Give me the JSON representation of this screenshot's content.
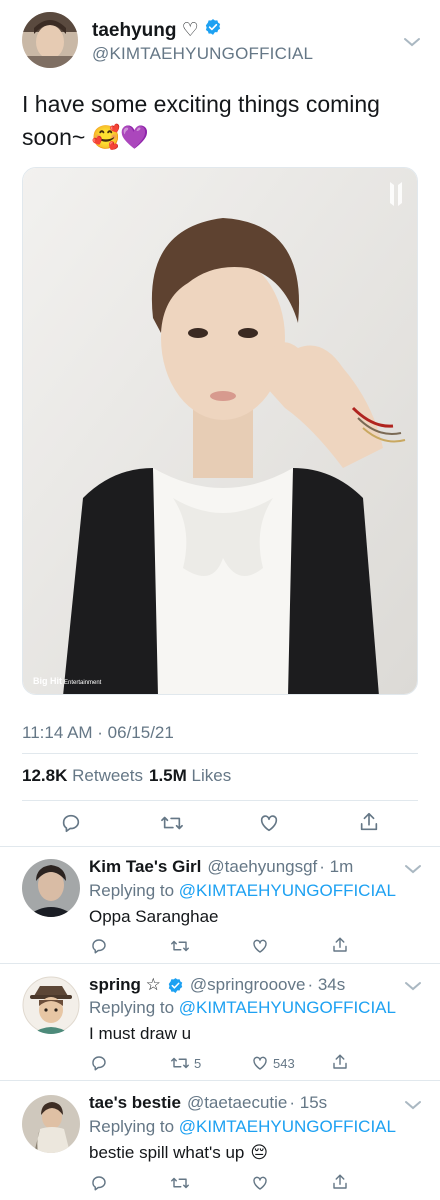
{
  "main_tweet": {
    "display_name": "taehyung ♡",
    "handle": "@KIMTAEHYUNGOFFICIAL",
    "text": "I have some exciting things coming soon~",
    "emoji": "🥰💜",
    "media_watermark": "Big Hit",
    "media_watermark_sub": "Entertainment",
    "timestamp": "11:14 AM · 06/15/21",
    "retweets_count": "12.8K",
    "retweets_label": "Retweets",
    "likes_count": "1.5M",
    "likes_label": "Likes"
  },
  "replies": [
    {
      "name": "Kim Tae's Girl",
      "handle": "@taehyungsgf",
      "time": "· 1m",
      "verified": false,
      "replying_prefix": "Replying to",
      "replying_to": "@KIMTAEHYUNGOFFICIAL",
      "text": "Oppa Saranghae",
      "retweet_count": "",
      "like_count": ""
    },
    {
      "name": "spring ☆",
      "handle": "@springrooove",
      "time": "· 34s",
      "verified": true,
      "replying_prefix": "Replying to",
      "replying_to": "@KIMTAEHYUNGOFFICIAL",
      "text": "I must draw u",
      "retweet_count": "5",
      "like_count": "543"
    },
    {
      "name": "tae's bestie",
      "handle": "@taetaecutie",
      "time": "· 15s",
      "verified": false,
      "replying_prefix": "Replying to",
      "replying_to": "@KIMTAEHYUNGOFFICIAL",
      "text": "bestie spill what's up",
      "emoji": "😔",
      "retweet_count": "",
      "like_count": ""
    }
  ],
  "icons": {
    "verified": "verified-badge-icon",
    "reply": "reply-icon",
    "retweet": "retweet-icon",
    "like": "heart-icon",
    "share": "share-icon",
    "more": "chevron-down-icon"
  },
  "colors": {
    "link": "#1da1f2",
    "secondary": "#657786",
    "divider": "#e1e8ed",
    "verified": "#1da1f2"
  }
}
